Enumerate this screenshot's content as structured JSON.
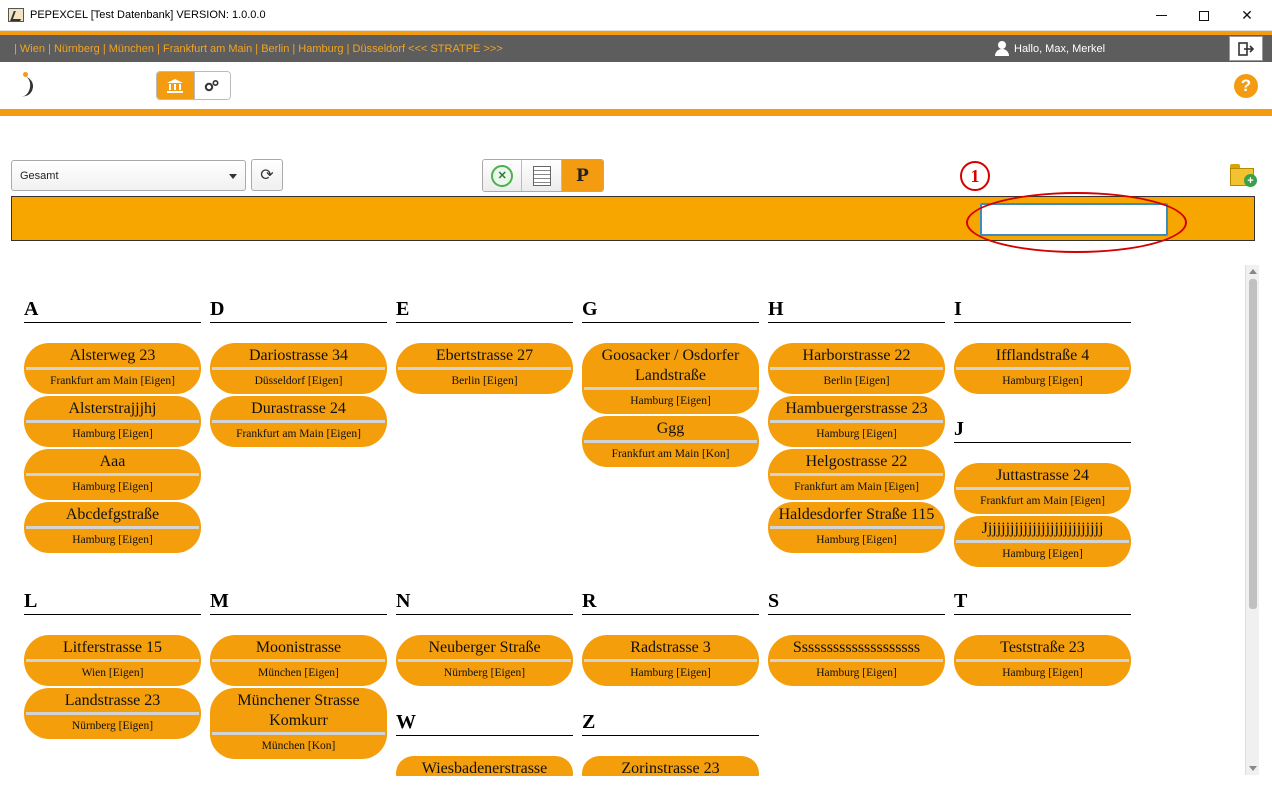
{
  "window": {
    "title": "PEPEXCEL [Test Datenbank] VERSION: 1.0.0.0",
    "minimize_label": "",
    "close_label": "✕"
  },
  "topbar": {
    "cities": "| Wien | Nürnberg | München | Frankfurt am Main | Berlin | Hamburg | Düsseldorf <<< STRATPE >>>",
    "greeting": "Hallo, Max, Merkel",
    "logout_icon": "logout-icon"
  },
  "toolbar": {
    "mode_buttons": [
      {
        "icon": "bank-icon",
        "glyph": "🏛"
      },
      {
        "icon": "gears-icon",
        "glyph": "⚙"
      }
    ],
    "help_label": "?"
  },
  "filter": {
    "select_value": "Gesamt",
    "refresh_glyph": "⟳",
    "view_p_label": "P",
    "excel_glyph": "✕",
    "marker_label": "1",
    "search_value": "",
    "search_placeholder": ""
  },
  "groups": [
    {
      "letter": "A",
      "cards": [
        {
          "name": "Alsterweg 23",
          "place": "Frankfurt am Main [Eigen]"
        },
        {
          "name": "Alsterstrajjjhj",
          "place": "Hamburg [Eigen]"
        },
        {
          "name": "Aaa",
          "place": "Hamburg [Eigen]"
        },
        {
          "name": "Abcdefgstraße",
          "place": "Hamburg [Eigen]"
        }
      ]
    },
    {
      "letter": "D",
      "cards": [
        {
          "name": "Dariostrasse 34",
          "place": "Düsseldorf [Eigen]"
        },
        {
          "name": "Durastrasse 24",
          "place": "Frankfurt am Main [Eigen]"
        }
      ]
    },
    {
      "letter": "E",
      "cards": [
        {
          "name": "Ebertstrasse 27",
          "place": "Berlin [Eigen]"
        }
      ]
    },
    {
      "letter": "G",
      "cards": [
        {
          "name": "Goosacker / Osdorfer Landstraße",
          "place": "Hamburg [Eigen]"
        },
        {
          "name": "Ggg",
          "place": "Frankfurt am Main [Kon]"
        }
      ]
    },
    {
      "letter": "H",
      "cards": [
        {
          "name": "Harborstrasse 22",
          "place": "Berlin [Eigen]"
        },
        {
          "name": "Hambuergerstrasse 23",
          "place": "Hamburg [Eigen]"
        },
        {
          "name": "Helgostrasse 22",
          "place": "Frankfurt am Main [Eigen]"
        },
        {
          "name": "Haldesdorfer Straße 115",
          "place": "Hamburg [Eigen]"
        }
      ]
    },
    {
      "letter": "I",
      "cards": [
        {
          "name": "Ifflandstraße 4",
          "place": "Hamburg [Eigen]"
        }
      ]
    },
    {
      "letter": "J",
      "cards": [
        {
          "name": "Juttastrasse 24",
          "place": "Frankfurt am Main [Eigen]"
        },
        {
          "name": "Jjjjjjjjjjjjjjjjjjjjjjjjjjj",
          "place": "Hamburg [Eigen]"
        }
      ]
    },
    {
      "letter": "L",
      "cards": [
        {
          "name": "Litferstrasse 15",
          "place": "Wien [Eigen]"
        },
        {
          "name": "Landstrasse 23",
          "place": "Nürnberg [Eigen]"
        }
      ]
    },
    {
      "letter": "M",
      "cards": [
        {
          "name": "Moonistrasse",
          "place": "München [Eigen]"
        },
        {
          "name": "Münchener Strasse Komkurr",
          "place": "München [Kon]"
        }
      ]
    },
    {
      "letter": "N",
      "cards": [
        {
          "name": "Neuberger Straße",
          "place": "Nürnberg [Eigen]"
        }
      ]
    },
    {
      "letter": "R",
      "cards": [
        {
          "name": "Radstrasse 3",
          "place": "Hamburg [Eigen]"
        }
      ]
    },
    {
      "letter": "S",
      "cards": [
        {
          "name": "Ssssssssssssssssssss",
          "place": "Hamburg [Eigen]"
        }
      ]
    },
    {
      "letter": "T",
      "cards": [
        {
          "name": "Teststraße 23",
          "place": "Hamburg [Eigen]"
        }
      ]
    },
    {
      "letter": "W",
      "cards": [
        {
          "name": "Wiesbadenerstrasse",
          "place": ""
        }
      ]
    },
    {
      "letter": "Z",
      "cards": [
        {
          "name": "Zorinstrasse 23",
          "place": ""
        }
      ]
    }
  ]
}
